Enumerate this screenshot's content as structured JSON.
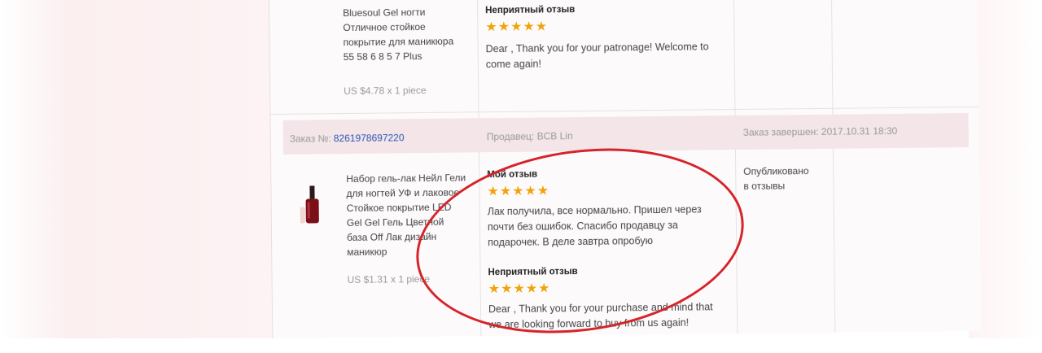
{
  "top_product": {
    "title_lines": [
      "Bluesoul Gel ногти",
      "Отличное стойкое",
      "покрытие для маникюра",
      "55 58 6 8 5 7 Plus"
    ],
    "price": "US $4.78 x 1 piece"
  },
  "top_review": {
    "heading": "Неприятный отзыв",
    "stars": "★★★★★",
    "text": "Dear , Thank you for your patronage! Welcome to come again!"
  },
  "order_bar": {
    "order_label": "Заказ №:",
    "order_number": "8261978697220",
    "store": "Продавец: BCB Lin",
    "completed": "Заказ завершен: 2017.10.31 18:30"
  },
  "bottom_product": {
    "title_lines": [
      "Набор гель-лак Нейл Гели",
      "для ногтей УФ и лаковое",
      "Стойкое покрытие LED",
      "Gel Gel Гель Цветной",
      "база Off Лак дизайн",
      "маникюр"
    ],
    "price": "US $1.31 x 1 piece"
  },
  "review_status": [
    "Опубликовано",
    "в отзывы"
  ],
  "my_review": {
    "heading": "Мой отзыв",
    "stars": "★★★★★",
    "text_lines": [
      "Лак получила, все нормально. Пришел через",
      "почти без ошибок. Спасибо продавцу за",
      "подарочек. В деле завтра опробую"
    ]
  },
  "seller_reply": {
    "heading": "Неприятный отзыв",
    "stars": "★★★★★",
    "text_lines": [
      "Dear , Thank you for your purchase and mind that",
      "we are looking forward to buy from us again!"
    ]
  },
  "colors": {
    "accent_star": "#f0a30a",
    "link": "#2c55b6",
    "annotation_circle": "#d5242a"
  }
}
